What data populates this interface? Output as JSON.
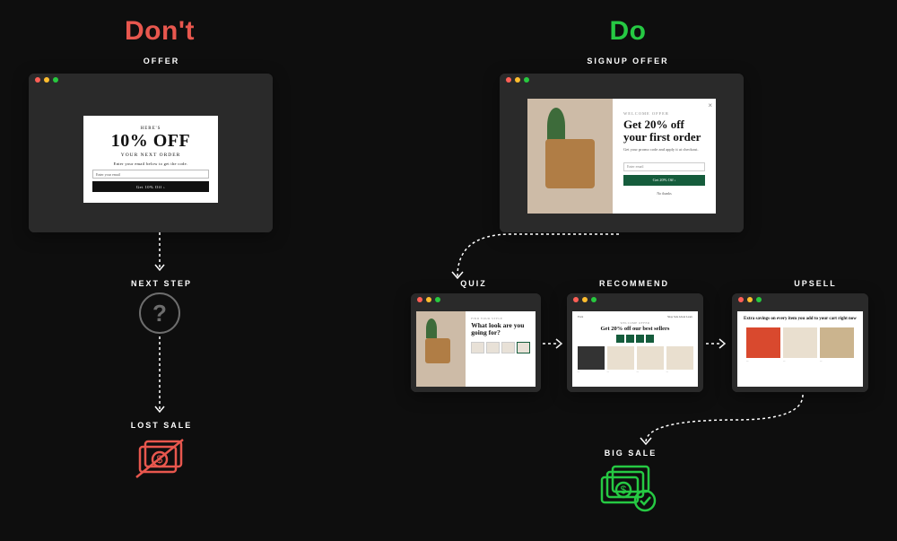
{
  "dont": {
    "title": "Don't",
    "offer_label": "OFFER",
    "modal": {
      "kicker": "HERE'S",
      "headline": "10% OFF",
      "subhead": "YOUR NEXT ORDER",
      "desc": "Enter your email below to get the code.",
      "placeholder": "Enter your email",
      "button": "Get 10% Off ›"
    },
    "next_label": "NEXT STEP",
    "question": "?",
    "lost_label": "LOST SALE"
  },
  "do": {
    "title": "Do",
    "signup_label": "SIGNUP OFFER",
    "modal": {
      "kicker": "WELCOME OFFER",
      "headline_l1": "Get 20% off",
      "headline_l2": "your first order",
      "desc": "Get your promo code and apply it at checkout.",
      "placeholder": "Enter email",
      "button": "Get 20% Off ›",
      "nothanks": "No thanks"
    },
    "quiz_label": "QUIZ",
    "quiz": {
      "kicker": "FIND YOUR STYLE",
      "headline": "What look are you going for?"
    },
    "rec_label": "RECOMMEND",
    "rec": {
      "brand": "Forst",
      "nav": "Shop   Sale   About   Learn",
      "kicker": "WELCOME OFFER",
      "headline": "Get 20% off  our best sellers"
    },
    "upsell_label": "UPSELL",
    "upsell": {
      "headline": "Extra savings on every item you add to your cart right now"
    },
    "bigsale_label": "BIG SALE"
  }
}
